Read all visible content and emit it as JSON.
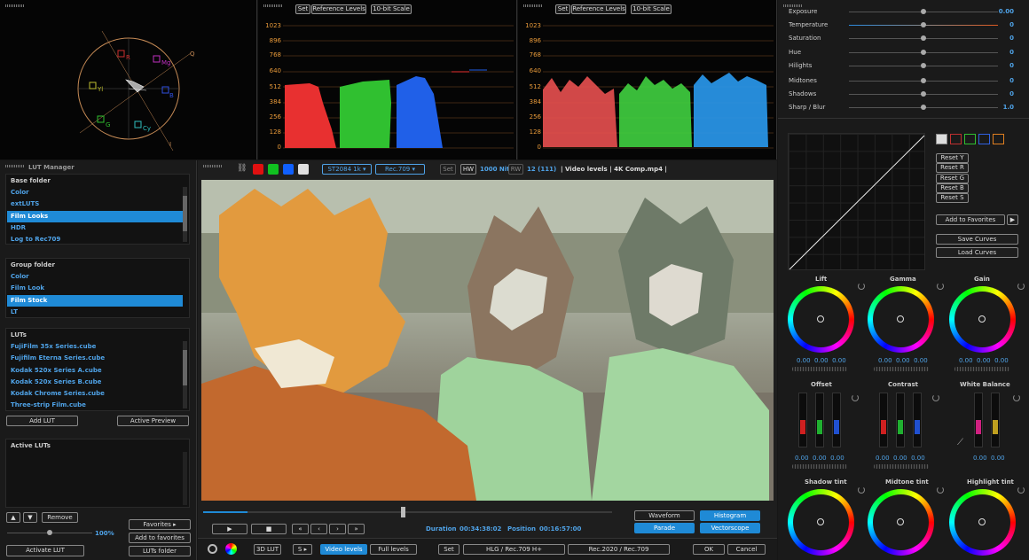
{
  "scopes": {
    "panel2_buttons": [
      "Set",
      "Reference Levels",
      "10-bit Scale"
    ],
    "panel3_buttons": [
      "Set",
      "Reference Levels",
      "10-bit Scale"
    ],
    "vectorscope_labels": [
      "R",
      "Mg",
      "B",
      "Cy",
      "G",
      "Yl",
      "Q",
      "I"
    ],
    "ticks": [
      "1023",
      "896",
      "768",
      "640",
      "512",
      "384",
      "256",
      "128",
      "0"
    ]
  },
  "lut_manager": {
    "title": "LUT Manager",
    "base_title": "Base folder",
    "base_items": [
      "Color",
      "extLUTS",
      "Film Looks",
      "HDR",
      "Log to Rec709"
    ],
    "base_selected": 2,
    "group_title": "Group folder",
    "group_items": [
      "Color",
      "Film Look",
      "Film Stock",
      "LT"
    ],
    "group_selected": 2,
    "luts_title": "LUTs",
    "luts_items": [
      "FujiFilm 35x Series.cube",
      "Fujifilm Eterna Series.cube",
      "Kodak 520x Series A.cube",
      "Kodak 520x Series B.cube",
      "Kodak Chrome Series.cube",
      "Three-strip Film.cube"
    ],
    "add_lut": "Add LUT",
    "active_preview": "Active Preview",
    "active_title": "Active LUTs",
    "remove": "Remove",
    "favorites": "Favorites",
    "zoom": "100%",
    "add_to_favorites": "Add to favorites",
    "activate": "Activate LUT",
    "luts_folder": "LUTs folder"
  },
  "viewer": {
    "colors": [
      "#e01010",
      "#10c020",
      "#1060ff",
      "#e0e0e0"
    ],
    "sel1": "ST2084 1k",
    "sel2": "Rec.709",
    "set": "Set",
    "hw": "HW",
    "nits": "1000 Nits",
    "rw": "RW",
    "bits": "12 (111)",
    "info": "| Video levels | 4K Comp.mp4 |"
  },
  "transport": {
    "duration_label": "Duration",
    "duration": "00:34:38:02",
    "position_label": "Position",
    "position": "00:16:57:00",
    "scope_btns": [
      "Waveform",
      "Histogram",
      "Parade",
      "Vectorscope"
    ],
    "play": "▶",
    "stop": "■",
    "nav": [
      "«",
      "‹",
      "›",
      "»"
    ]
  },
  "bottom": {
    "lut3d": "3D LUT",
    "s": "S",
    "video_levels": "Video levels",
    "full_levels": "Full levels",
    "set": "Set",
    "hlg": "HLG / Rec.709 H+",
    "rec2020": "Rec.2020 / Rec.709",
    "ok": "OK",
    "cancel": "Cancel"
  },
  "sliders": [
    {
      "label": "Exposure",
      "value": "0.00",
      "pos": 0.5
    },
    {
      "label": "Temperature",
      "value": "0",
      "pos": 0.5
    },
    {
      "label": "Saturation",
      "value": "0",
      "pos": 0.5
    },
    {
      "label": "Hue",
      "value": "0",
      "pos": 0.5
    },
    {
      "label": "Hilights",
      "value": "0",
      "pos": 0.5
    },
    {
      "label": "Midtones",
      "value": "0",
      "pos": 0.5
    },
    {
      "label": "Shadows",
      "value": "0",
      "pos": 0.5
    },
    {
      "label": "Sharp / Blur",
      "value": "1.0",
      "pos": 0.5
    }
  ],
  "curves": {
    "resets": [
      "Reset Y",
      "Reset R",
      "Reset G",
      "Reset B",
      "Reset S"
    ],
    "add_fav": "Add to Favorites",
    "save": "Save Curves",
    "load": "Load Curves"
  },
  "wheels": {
    "lift": "Lift",
    "gamma": "Gamma",
    "gain": "Gain",
    "offset": "Offset",
    "contrast": "Contrast",
    "wb": "White Balance",
    "shadow": "Shadow tint",
    "midtone": "Midtone tint",
    "highlight": "Highlight tint",
    "val": "0.00"
  }
}
